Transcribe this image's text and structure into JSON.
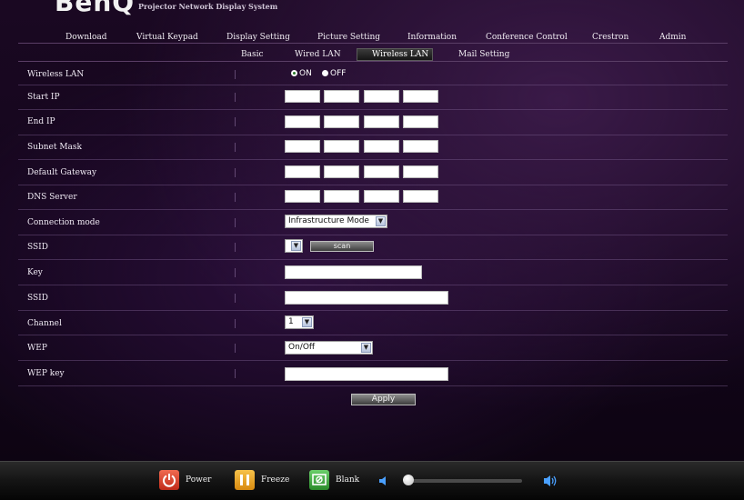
{
  "header": {
    "logo": "BenQ",
    "system_name": "Projector Network Display System"
  },
  "nav": {
    "items": [
      "Download",
      "Virtual Keypad",
      "Display Setting",
      "Picture Setting",
      "Information",
      "Conference Control",
      "Crestron",
      "Admin"
    ]
  },
  "subnav": {
    "items": [
      "Basic",
      "Wired LAN",
      "Wireless LAN",
      "Mail Setting"
    ],
    "active": "Wireless LAN"
  },
  "form": {
    "wireless_lan": {
      "label": "Wireless LAN",
      "options": [
        "ON",
        "OFF"
      ],
      "selected": "ON"
    },
    "start_ip": {
      "label": "Start IP"
    },
    "end_ip": {
      "label": "End IP"
    },
    "subnet_mask": {
      "label": "Subnet Mask"
    },
    "default_gateway": {
      "label": "Default Gateway"
    },
    "dns_server": {
      "label": "DNS Server"
    },
    "connection_mode": {
      "label": "Connection mode",
      "value": "Infrastructure Mode"
    },
    "ssid_select": {
      "label": "SSID",
      "value": "",
      "scan_label": "scan"
    },
    "key": {
      "label": "Key"
    },
    "ssid_text": {
      "label": "SSID"
    },
    "channel": {
      "label": "Channel",
      "value": "1"
    },
    "wep": {
      "label": "WEP",
      "value": "On/Off"
    },
    "wep_key": {
      "label": "WEP key"
    },
    "apply_label": "Apply"
  },
  "footer": {
    "power_label": "Power",
    "freeze_label": "Freeze",
    "blank_label": "Blank",
    "volume_level": 0.0,
    "icons": [
      "power-icon",
      "freeze-icon",
      "blank-icon",
      "volume-low-icon",
      "volume-high-icon"
    ],
    "colors": {
      "power": "#e0442a",
      "freeze": "#f0a020",
      "blank": "#3aa83a"
    }
  }
}
